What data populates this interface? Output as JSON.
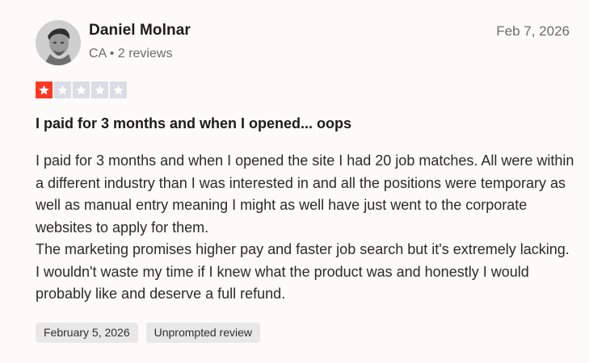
{
  "reviewer": {
    "name": "Daniel Molnar",
    "country": "CA",
    "separator": "•",
    "reviews_count": "2 reviews"
  },
  "review_date": "Feb 7, 2026",
  "rating": {
    "value": 1,
    "max": 5,
    "on_color": "#ff3722",
    "off_color": "#dcdce6"
  },
  "review": {
    "title": "I paid for 3 months and when I opened... oops",
    "paragraphs": [
      "I paid for 3 months and when I opened the site I had 20 job matches. All were within a different industry than I was interested in and all the positions were temporary as well as manual entry meaning I might as well have just went to the corporate websites to apply for them.",
      "The marketing promises higher pay and faster job search but it's extremely lacking. I wouldn't waste my time if I knew what the product was and honestly I would probably like and deserve a full refund."
    ]
  },
  "tags": {
    "experience_date": "February 5, 2026",
    "review_type": "Unprompted review"
  },
  "icons": {
    "avatar": "user-photo-avatar",
    "star": "star-icon"
  }
}
